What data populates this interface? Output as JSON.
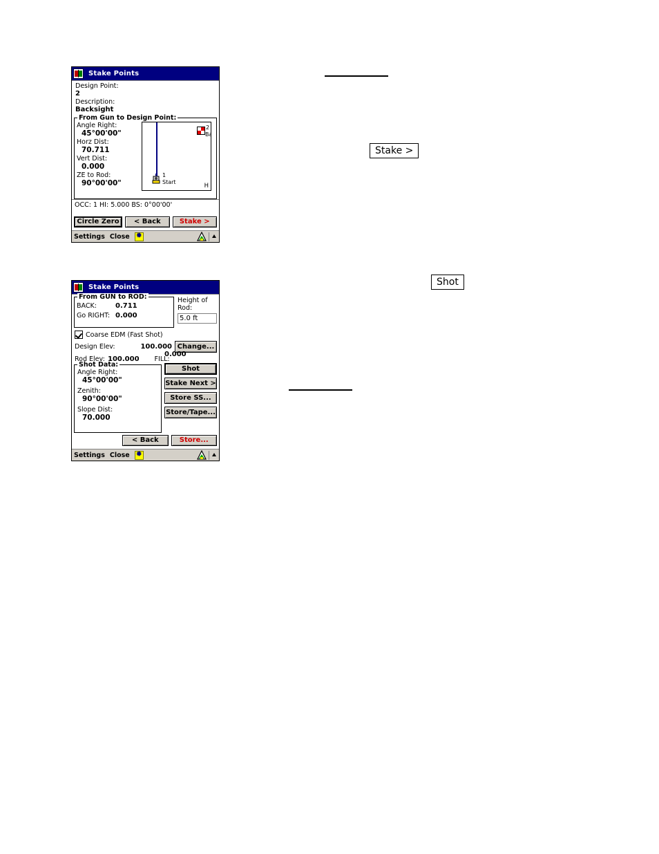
{
  "window1": {
    "titlebar": {
      "icon": "notebook-icon",
      "title": "Stake Points"
    },
    "fields": {
      "design_point_label": "Design Point:",
      "design_point_value": "2",
      "description_label": "Description:",
      "description_value": "Backsight"
    },
    "group": {
      "title": "From Gun to Design Point:",
      "rows": [
        {
          "label": "Angle Right:",
          "value": "45°00'00\""
        },
        {
          "label": "Horz Dist:",
          "value": "70.711"
        },
        {
          "label": "Vert Dist:",
          "value": "0.000"
        },
        {
          "label": "ZE to Rod:",
          "value": "90°00'00\""
        }
      ]
    },
    "map": {
      "occupied_label": "1",
      "occupied_sublabel": "Start",
      "backsight_label": "2",
      "backsight_sublabel": "Ba",
      "corner_label": "H",
      "line_color": "#000080",
      "target_color": "#e00000"
    },
    "status_line": "OCC: 1  HI: 5.000  BS: 0°00'00'",
    "buttons": {
      "circle_zero": "Circle Zero",
      "back": "< Back",
      "stake": "Stake >"
    },
    "taskbar": {
      "settings": "Settings",
      "close": "Close",
      "star_icon": "star-icon",
      "tripod_icon": "tripod-icon",
      "up_icon": "chevron-up-icon"
    }
  },
  "window2": {
    "titlebar": {
      "icon": "notebook-icon",
      "title": "Stake Points"
    },
    "gun_to_rod": {
      "title": "From GUN to ROD:",
      "rows": [
        {
          "label": "BACK:",
          "value": "0.711"
        },
        {
          "label": "Go RIGHT:",
          "value": "0.000"
        }
      ]
    },
    "height_of_rod": {
      "label_line1": "Height of",
      "label_line2": "Rod:",
      "value": "5.0 ft"
    },
    "coarse_edm": {
      "label": "Coarse EDM (Fast Shot)",
      "checked": true
    },
    "design_elev": {
      "label": "Design Elev:",
      "value": "100.000"
    },
    "change_button": "Change...",
    "rod_elev": {
      "label": "Rod Elev:",
      "value": "100.000"
    },
    "fill": {
      "label": "FILL:",
      "value": "0.000"
    },
    "shot_data": {
      "title": "Shot Data:",
      "rows": [
        {
          "label": "Angle Right:",
          "value": "45°00'00\""
        },
        {
          "label": "Zenith:",
          "value": "90°00'00\""
        },
        {
          "label": "Slope Dist:",
          "value": "70.000"
        }
      ]
    },
    "side_buttons": [
      {
        "label": "Shot",
        "name": "shot-button",
        "style": "default"
      },
      {
        "label": "Stake Next >",
        "name": "stake-next-button",
        "style": "normal"
      },
      {
        "label": "Store SS...",
        "name": "store-ss-button",
        "style": "normal"
      },
      {
        "label": "Store/Tape...",
        "name": "store-tape-button",
        "style": "normal"
      }
    ],
    "buttons": {
      "back": "< Back",
      "store": "Store..."
    },
    "taskbar": {
      "settings": "Settings",
      "close": "Close",
      "star_icon": "star-icon",
      "tripod_icon": "tripod-icon",
      "up_icon": "chevron-up-icon"
    }
  },
  "annotations": {
    "callout1": "Stake >",
    "callout2": "Shot"
  }
}
